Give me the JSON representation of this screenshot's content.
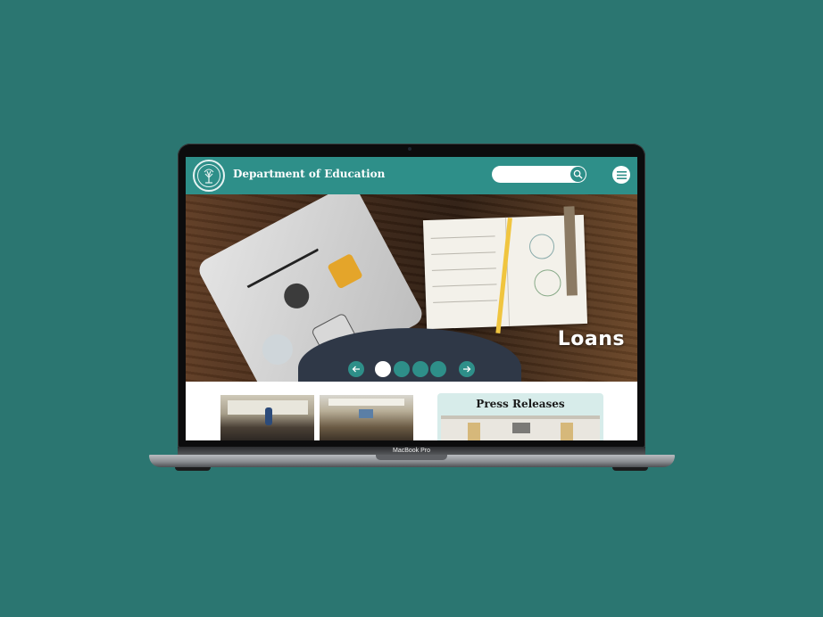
{
  "site": {
    "title": "Department of Education"
  },
  "search": {
    "placeholder": ""
  },
  "hero": {
    "caption": "Loans",
    "slide_count": 4,
    "active_slide": 1
  },
  "press": {
    "title": "Press Releases"
  },
  "device": {
    "label": "MacBook Pro"
  },
  "colors": {
    "background": "#2b7671",
    "brand_teal": "#2e8f89",
    "press_bg": "#d7ecea"
  },
  "icons": {
    "search": "search-icon",
    "menu": "hamburger-menu-icon",
    "prev": "arrow-left-icon",
    "next": "arrow-right-icon"
  }
}
